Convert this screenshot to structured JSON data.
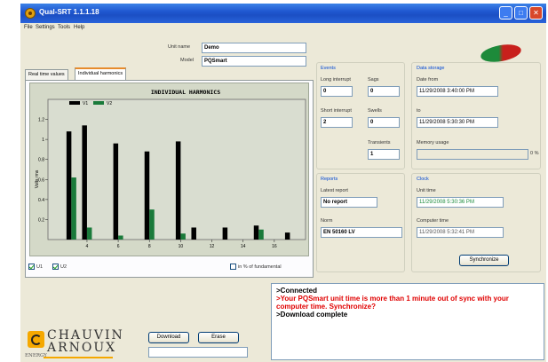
{
  "window": {
    "title": "Qual-SRT 1.1.1.18"
  },
  "menu": [
    "File",
    "Settings",
    "Tools",
    "Help"
  ],
  "unit": {
    "unit_name_label": "Unit name",
    "unit_name_value": "Demo",
    "model_label": "Model",
    "model_value": "PQSmart"
  },
  "tabs": [
    "Real time values",
    "Individual harmonics"
  ],
  "chart_data": {
    "type": "bar",
    "title": "INDIVIDUAL HARMONICS",
    "ylabel": "Volts rms",
    "ylim": [
      0,
      1.4
    ],
    "yticks": [
      "1.2",
      "1",
      "0.8",
      "0.6",
      "0.4",
      "0.2"
    ],
    "xticks": [
      "4",
      "6",
      "8",
      "10",
      "12",
      "14",
      "16"
    ],
    "x": [
      3,
      4,
      6,
      8,
      10,
      11,
      13,
      15,
      17
    ],
    "series": [
      {
        "name": "V1",
        "color": "#000000",
        "values": [
          1.08,
          1.14,
          0.96,
          0.88,
          0.98,
          0.12,
          0.12,
          0.14,
          0.07
        ]
      },
      {
        "name": "V2",
        "color": "#1a7a3a",
        "values": [
          0.62,
          0.12,
          0.04,
          0.3,
          0.06,
          0.0,
          0.0,
          0.1,
          0.0
        ]
      }
    ],
    "legend": "top-left"
  },
  "chart_controls": {
    "cb_v1": "U1",
    "cb_v2": "U2",
    "cb_fundamental": "in % of fundamental"
  },
  "events": {
    "title": "Events",
    "long_interrupt_label": "Long interrupt",
    "long_interrupt_value": "0",
    "sags_label": "Sags",
    "sags_value": "0",
    "short_interrupt_label": "Short interrupt",
    "short_interrupt_value": "2",
    "swells_label": "Swells",
    "swells_value": "0",
    "transients_label": "Transients",
    "transients_value": "1"
  },
  "data_storage": {
    "title": "Data storage",
    "date_from_label": "Date from",
    "date_from_value": "11/29/2008 3:40:00 PM",
    "to_label": "to",
    "to_value": "11/29/2008 5:30:30 PM",
    "memory_label": "Memory usage",
    "memory_percent": "0 %",
    "memory_fraction": 0.0
  },
  "reports": {
    "title": "Reports",
    "latest_label": "Latest report",
    "latest_value": "No report",
    "norm_label": "Norm",
    "norm_value": "EN 50160 LV"
  },
  "clock": {
    "title": "Clock",
    "unit_time_label": "Unit time",
    "unit_time_value": "11/29/2008 5:30:36 PM",
    "computer_time_label": "Computer time",
    "computer_time_value": "11/29/2008 5:32:41 PM",
    "sync_button": "Synchronize"
  },
  "actions": {
    "download_button": "Download",
    "erase_button": "Erase"
  },
  "messages": [
    {
      "text": ">Connected",
      "color": "#000000"
    },
    {
      "text": ">Your PQSmart unit time is more than 1 minute out of sync with your computer time. Synchronize?",
      "color": "#e00000"
    },
    {
      "text": ">Download complete",
      "color": "#000000"
    }
  ],
  "brand": {
    "line1": "CHAUVIN",
    "line2": "ARNOUX",
    "energy": "ENERGY"
  }
}
